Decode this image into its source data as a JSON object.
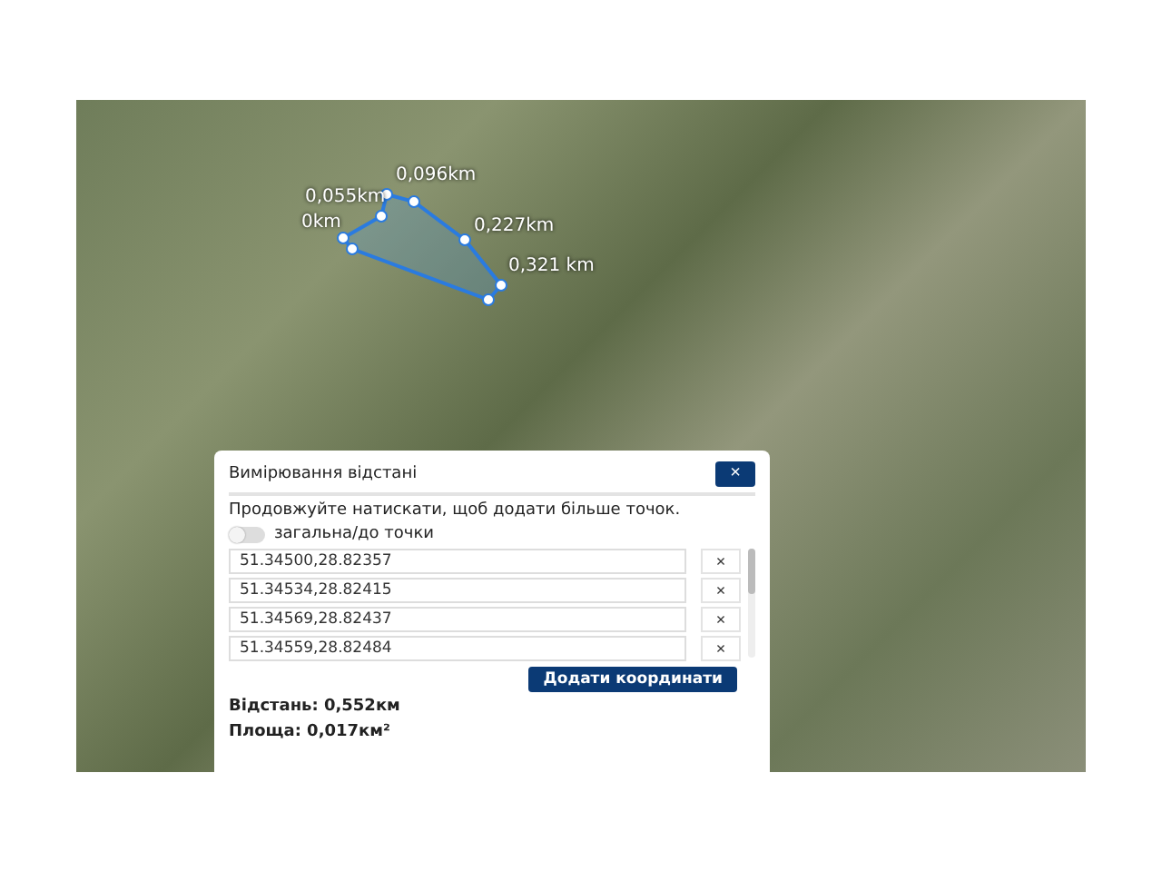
{
  "map": {
    "measure_labels": [
      "0,096km",
      "0,055km",
      "0km",
      "0,227km",
      "0,321 km"
    ]
  },
  "dialog": {
    "title": "Вимірювання відстані",
    "close": "×",
    "hint": "Продовжуйте натискати, щоб додати більше точок.",
    "toggle": {
      "label": "загальна/до точки",
      "on": false
    },
    "points": [
      {
        "value": "51.34500,28.82357",
        "remove": "×"
      },
      {
        "value": "51.34534,28.82415",
        "remove": "×"
      },
      {
        "value": "51.34569,28.82437",
        "remove": "×"
      },
      {
        "value": "51.34559,28.82484",
        "remove": "×"
      }
    ],
    "add_button": "Додати координати",
    "distance": "Відстань: 0,552км",
    "area": "Площа: 0,017км²"
  }
}
